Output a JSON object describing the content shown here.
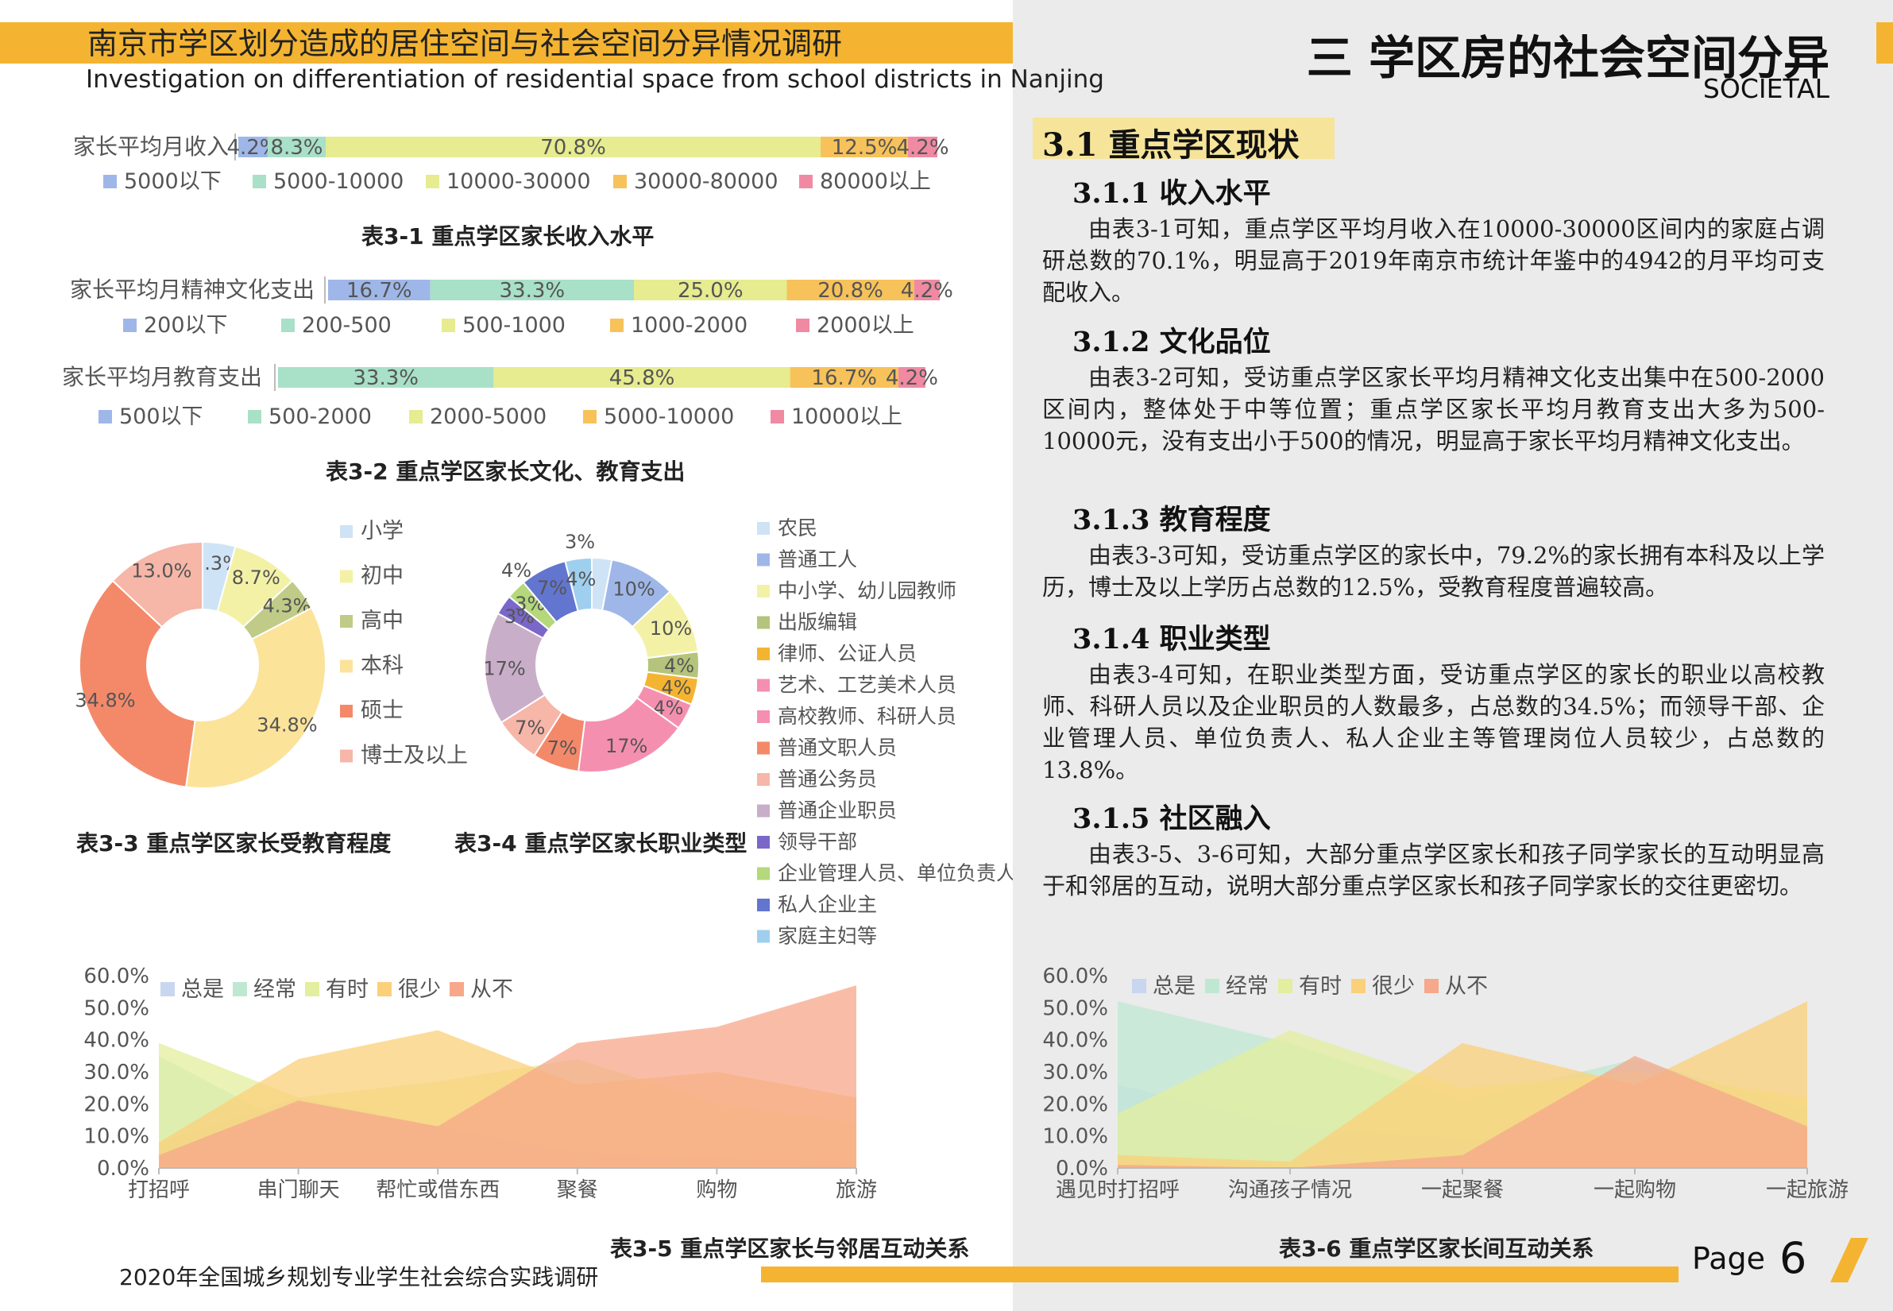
{
  "header": {
    "title_cn": "南京市学区划分造成的居住空间与社会空间分异情况调研",
    "title_en": "Investigation on differentiation of residential space from school districts in Nanjing",
    "section_title": "三  学区房的社会空间分异",
    "section_en": "SOCIETAL"
  },
  "colors": {
    "accent": "#f4b431",
    "blue": "#9fb7e8",
    "teal": "#a8e0c8",
    "lime": "#e6ec8f",
    "orange": "#f7c25a",
    "pink": "#f08aa3"
  },
  "chart_data": [
    {
      "type": "bar",
      "id": "income",
      "categories": [
        "家长平均月收入"
      ],
      "series": [
        {
          "name": "5000以下",
          "values": [
            4.2
          ],
          "label": "4.2%"
        },
        {
          "name": "5000-10000",
          "values": [
            8.3
          ],
          "label": "8.3%"
        },
        {
          "name": "10000-30000",
          "values": [
            70.8
          ],
          "label": "70.8%"
        },
        {
          "name": "30000-80000",
          "values": [
            12.5
          ],
          "label": "12.5%"
        },
        {
          "name": "80000以上",
          "values": [
            4.2
          ],
          "label": "4.2%"
        }
      ]
    },
    {
      "type": "bar",
      "id": "culture",
      "categories": [
        "家长平均月精神文化支出"
      ],
      "series": [
        {
          "name": "200以下",
          "values": [
            16.7
          ],
          "label": "16.7%"
        },
        {
          "name": "200-500",
          "values": [
            33.3
          ],
          "label": "33.3%"
        },
        {
          "name": "500-1000",
          "values": [
            25.0
          ],
          "label": "25.0%"
        },
        {
          "name": "1000-2000",
          "values": [
            20.8
          ],
          "label": "20.8%"
        },
        {
          "name": "2000以上",
          "values": [
            4.2
          ],
          "label": "4.2%"
        }
      ]
    },
    {
      "type": "bar",
      "id": "education_spend",
      "categories": [
        "家长平均月教育支出"
      ],
      "series": [
        {
          "name": "500以下",
          "values": [
            0
          ],
          "label": "0"
        },
        {
          "name": "500-2000",
          "values": [
            33.3
          ],
          "label": "33.3%"
        },
        {
          "name": "2000-5000",
          "values": [
            45.8
          ],
          "label": "45.8%"
        },
        {
          "name": "5000-10000",
          "values": [
            16.7
          ],
          "label": "16.7%"
        },
        {
          "name": "10000以上",
          "values": [
            4.2
          ],
          "label": "4.2%"
        }
      ]
    },
    {
      "type": "pie",
      "id": "education_level",
      "labels": [
        "小学",
        "初中",
        "高中",
        "本科",
        "硕士",
        "博士及以上"
      ],
      "values": [
        4.3,
        8.7,
        4.3,
        34.8,
        34.8,
        13.0
      ],
      "value_labels": [
        "4.3%",
        "8.7%",
        "4.3%",
        "34.8%",
        "34.8%",
        "13.0%"
      ],
      "colors": [
        "#cfe3f6",
        "#f3f1a6",
        "#bfcb86",
        "#fbe39a",
        "#f4896a",
        "#f6b6a8"
      ]
    },
    {
      "type": "pie",
      "id": "occupation",
      "labels": [
        "农民",
        "普通工人",
        "中小学、幼儿园教师",
        "出版编辑",
        "律师、公证人员",
        "艺术、工艺美术人员",
        "高校教师、科研人员",
        "普通文职人员",
        "普通公务员",
        "普通企业职员",
        "领导干部",
        "企业管理人员、单位负责人",
        "私人企业主",
        "家庭主妇等"
      ],
      "values": [
        3,
        10,
        10,
        4,
        4,
        4,
        17,
        7,
        7,
        17,
        3,
        3,
        7,
        4
      ],
      "value_labels": [
        "",
        "10%",
        "10%",
        "4%",
        "4%",
        "4%",
        "17%",
        "7%",
        "7%",
        "17%",
        "3%",
        "3%",
        "7%",
        "4%"
      ],
      "colors": [
        "#cfe3f6",
        "#9fb7e8",
        "#f3f1a6",
        "#b4c47c",
        "#f4b431",
        "#f58fb0",
        "#f58fb0",
        "#f4896a",
        "#f6b6a8",
        "#c9aec9",
        "#7b67c9",
        "#b4d87a",
        "#6275cf",
        "#9fcfef"
      ],
      "extra_labels": [
        "3%",
        "4%"
      ]
    },
    {
      "type": "area",
      "id": "neighbor",
      "categories": [
        "打招呼",
        "串门聊天",
        "帮忙或借东西",
        "聚餐",
        "购物",
        "旅游"
      ],
      "ylim": [
        0,
        60
      ],
      "yticks": [
        "0.0%",
        "10.0%",
        "20.0%",
        "30.0%",
        "40.0%",
        "50.0%",
        "60.0%"
      ],
      "series": [
        {
          "name": "总是",
          "values": [
            8,
            22,
            13,
            1,
            1,
            1
          ],
          "color": "#c8d6f0"
        },
        {
          "name": "经常",
          "values": [
            35,
            12,
            13,
            5,
            3,
            2
          ],
          "color": "#bfe8d2"
        },
        {
          "name": "有时",
          "values": [
            39,
            22,
            27,
            34,
            20,
            14
          ],
          "color": "#e3ee9e"
        },
        {
          "name": "很少",
          "values": [
            8,
            34,
            43,
            26,
            30,
            22
          ],
          "color": "#fbd07a"
        },
        {
          "name": "从不",
          "values": [
            4,
            21,
            13,
            39,
            44,
            57
          ],
          "color": "#f7a78a"
        }
      ]
    },
    {
      "type": "area",
      "id": "parents",
      "categories": [
        "遇见时打招呼",
        "沟通孩子情况",
        "一起聚餐",
        "一起购物",
        "一起旅游"
      ],
      "ylim": [
        0,
        60
      ],
      "yticks": [
        "0.0%",
        "10.0%",
        "20.0%",
        "30.0%",
        "40.0%",
        "50.0%",
        "60.0%"
      ],
      "series": [
        {
          "name": "总是",
          "values": [
            26,
            13,
            9,
            8,
            8
          ],
          "color": "#c8d6f0"
        },
        {
          "name": "经常",
          "values": [
            52,
            39,
            21,
            34,
            18
          ],
          "color": "#bfe8d2"
        },
        {
          "name": "有时",
          "values": [
            17,
            43,
            25,
            30,
            22
          ],
          "color": "#e3ee9e"
        },
        {
          "name": "很少",
          "values": [
            4,
            2,
            39,
            26,
            52
          ],
          "color": "#fbd07a"
        },
        {
          "name": "从不",
          "values": [
            1,
            0,
            4,
            35,
            13
          ],
          "color": "#f7a78a"
        }
      ]
    }
  ],
  "captions": {
    "t31": "表3-1 重点学区家长收入水平",
    "t32": "表3-2 重点学区家长文化、教育支出",
    "t33": "表3-3 重点学区家长受教育程度",
    "t34": "表3-4 重点学区家长职业类型",
    "t35": "表3-5 重点学区家长与邻居互动关系",
    "t36": "表3-6 重点学区家长间互动关系"
  },
  "content": {
    "sub_title": "3.1  重点学区现状",
    "s1_title": "3.1.1  收入水平",
    "s1_text": "由表3-1可知，重点学区平均月收入在10000-30000区间内的家庭占调研总数的70.1%，明显高于2019年南京市统计年鉴中的4942的月平均可支配收入。",
    "s2_title": "3.1.2  文化品位",
    "s2_text": "由表3-2可知，受访重点学区家长平均月精神文化支出集中在500-2000区间内，整体处于中等位置；重点学区家长平均月教育支出大多为500-10000元，没有支出小于500的情况，明显高于家长平均月精神文化支出。",
    "s3_title": "3.1.3  教育程度",
    "s3_text": "由表3-3可知，受访重点学区的家长中，79.2%的家长拥有本科及以上学历，博士及以上学历占总数的12.5%，受教育程度普遍较高。",
    "s4_title": "3.1.4  职业类型",
    "s4_text": "由表3-4可知，在职业类型方面，受访重点学区的家长的职业以高校教师、科研人员以及企业职员的人数最多，占总数的34.5%；而领导干部、企业管理人员、单位负责人、私人企业主等管理岗位人员较少，占总数的13.8%。",
    "s5_title": "3.1.5  社区融入",
    "s5_text": "由表3-5、3-6可知，大部分重点学区家长和孩子同学家长的互动明显高于和邻居的互动，说明大部分重点学区家长和孩子同学家长的交往更密切。"
  },
  "footer": {
    "text": "2020年全国城乡规划专业学生社会综合实践调研",
    "page_label": "Page",
    "page_number": "6"
  }
}
